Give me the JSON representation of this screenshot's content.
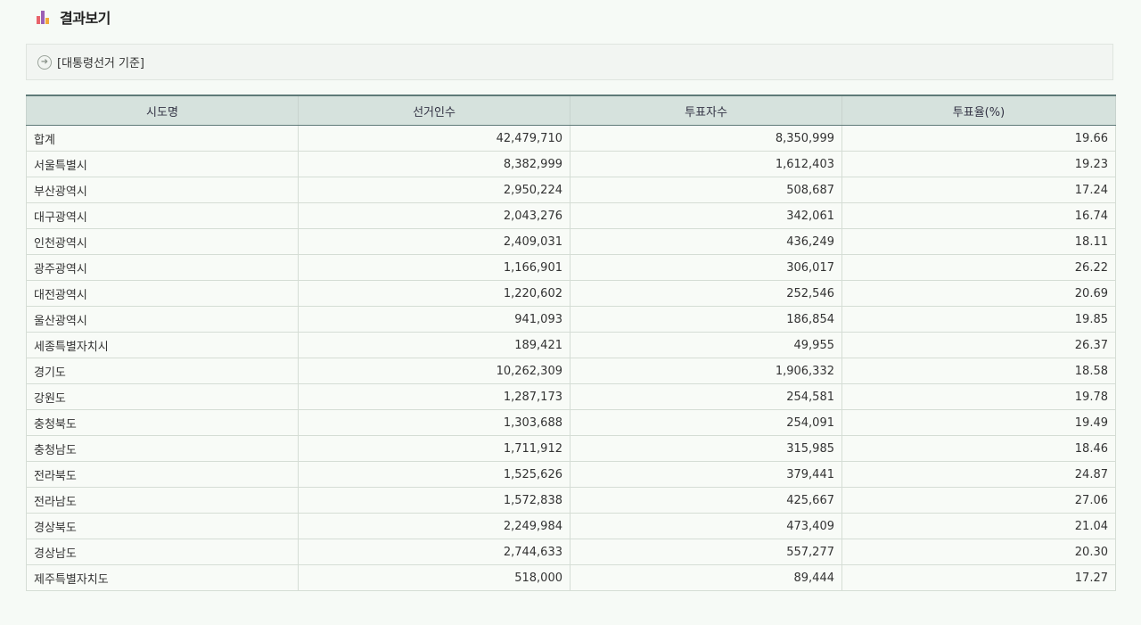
{
  "header": {
    "title": "결과보기",
    "icon": "bar-chart-icon"
  },
  "criteria": {
    "text": "[대통령선거 기준]",
    "icon": "circle-arrow-right-icon"
  },
  "table": {
    "columns": [
      "시도명",
      "선거인수",
      "투표자수",
      "투표율(%)"
    ],
    "rows": [
      [
        "합계",
        "42,479,710",
        "8,350,999",
        "19.66"
      ],
      [
        "서울특별시",
        "8,382,999",
        "1,612,403",
        "19.23"
      ],
      [
        "부산광역시",
        "2,950,224",
        "508,687",
        "17.24"
      ],
      [
        "대구광역시",
        "2,043,276",
        "342,061",
        "16.74"
      ],
      [
        "인천광역시",
        "2,409,031",
        "436,249",
        "18.11"
      ],
      [
        "광주광역시",
        "1,166,901",
        "306,017",
        "26.22"
      ],
      [
        "대전광역시",
        "1,220,602",
        "252,546",
        "20.69"
      ],
      [
        "울산광역시",
        "941,093",
        "186,854",
        "19.85"
      ],
      [
        "세종특별자치시",
        "189,421",
        "49,955",
        "26.37"
      ],
      [
        "경기도",
        "10,262,309",
        "1,906,332",
        "18.58"
      ],
      [
        "강원도",
        "1,287,173",
        "254,581",
        "19.78"
      ],
      [
        "충청북도",
        "1,303,688",
        "254,091",
        "19.49"
      ],
      [
        "충청남도",
        "1,711,912",
        "315,985",
        "18.46"
      ],
      [
        "전라북도",
        "1,525,626",
        "379,441",
        "24.87"
      ],
      [
        "전라남도",
        "1,572,838",
        "425,667",
        "27.06"
      ],
      [
        "경상북도",
        "2,249,984",
        "473,409",
        "21.04"
      ],
      [
        "경상남도",
        "2,744,633",
        "557,277",
        "20.30"
      ],
      [
        "제주특별자치도",
        "518,000",
        "89,444",
        "17.27"
      ]
    ]
  }
}
